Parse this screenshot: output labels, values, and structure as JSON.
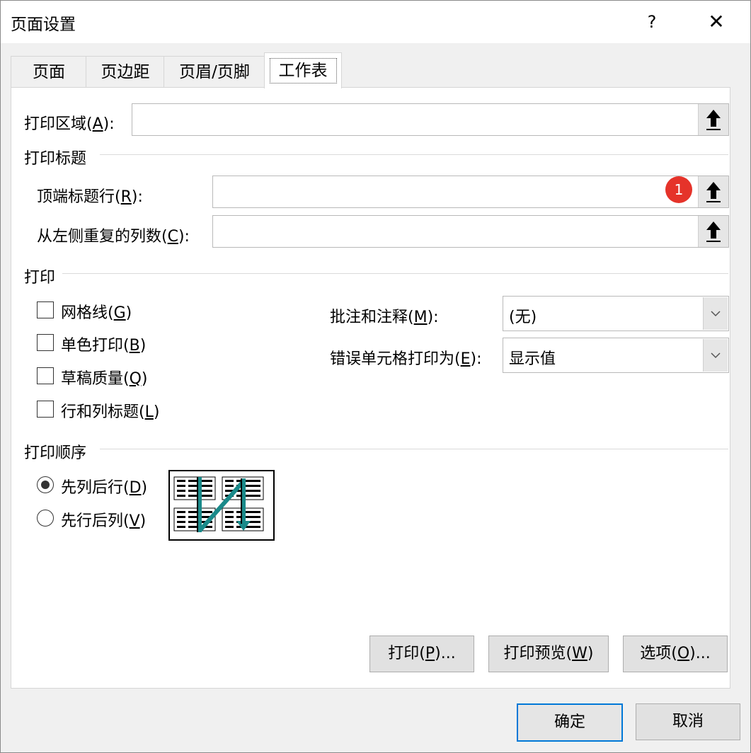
{
  "window": {
    "title": "页面设置",
    "help": "?",
    "close": "✕"
  },
  "tabs": [
    {
      "label": "页面"
    },
    {
      "label": "页边距"
    },
    {
      "label": "页眉/页脚"
    },
    {
      "label": "工作表"
    }
  ],
  "print_area": {
    "label": "打印区域(",
    "key": "A",
    "suffix": "):",
    "value": ""
  },
  "print_titles": {
    "heading": "打印标题",
    "rows_label": "顶端标题行(",
    "rows_key": "R",
    "rows_suffix": "):",
    "rows_value": "",
    "cols_label": "从左侧重复的列数(",
    "cols_key": "C",
    "cols_suffix": "):",
    "cols_value": ""
  },
  "badge": "1",
  "print": {
    "heading": "打印",
    "gridlines": {
      "label": "网格线(",
      "key": "G",
      "suffix": ")",
      "checked": false
    },
    "mono": {
      "label": "单色打印(",
      "key": "B",
      "suffix": ")",
      "checked": false
    },
    "draft": {
      "label": "草稿质量(",
      "key": "Q",
      "suffix": ")",
      "checked": false
    },
    "headings": {
      "label": "行和列标题(",
      "key": "L",
      "suffix": ")",
      "checked": false
    },
    "comments_label": "批注和注释(",
    "comments_key": "M",
    "comments_suffix": "):",
    "comments_value": "(无)",
    "errors_label": "错误单元格打印为(",
    "errors_key": "E",
    "errors_suffix": "):",
    "errors_value": "显示值"
  },
  "page_order": {
    "heading": "打印顺序",
    "down_label": "先列后行(",
    "down_key": "D",
    "down_suffix": ")",
    "over_label": "先行后列(",
    "over_key": "V",
    "over_suffix": ")",
    "selected": "down"
  },
  "panel_buttons": {
    "print": {
      "label": "打印(",
      "key": "P",
      "suffix": ")..."
    },
    "preview": {
      "label": "打印预览(",
      "key": "W",
      "suffix": ")"
    },
    "options": {
      "label": "选项(",
      "key": "O",
      "suffix": ")..."
    }
  },
  "footer": {
    "ok": "确定",
    "cancel": "取消"
  },
  "colors": {
    "accent": "#0078d7",
    "badge": "#e5332a",
    "arrow_teal": "#1a8a8a"
  }
}
